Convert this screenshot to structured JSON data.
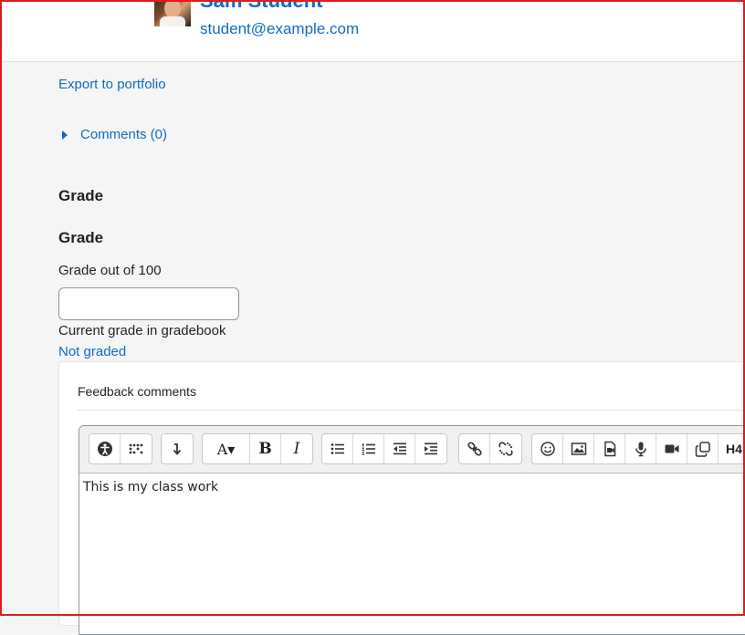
{
  "user": {
    "name": "Sam Student",
    "email": "student@example.com"
  },
  "links": {
    "export": "Export to portfolio",
    "comments": "Comments (0)"
  },
  "grade": {
    "section_heading": "Grade",
    "subheading": "Grade",
    "out_of_label": "Grade out of 100",
    "input_value": "",
    "current_label": "Current grade in gradebook",
    "current_value": "Not graded"
  },
  "feedback": {
    "title": "Feedback comments",
    "content": "This is my class work",
    "toolbar_glyphs": {
      "font": "A▾",
      "bold": "B",
      "italic": "I",
      "more": "H4"
    }
  },
  "colors": {
    "link": "#0f6cbf",
    "frame": "#e01b1b",
    "page_bg": "#f5f5f5"
  }
}
